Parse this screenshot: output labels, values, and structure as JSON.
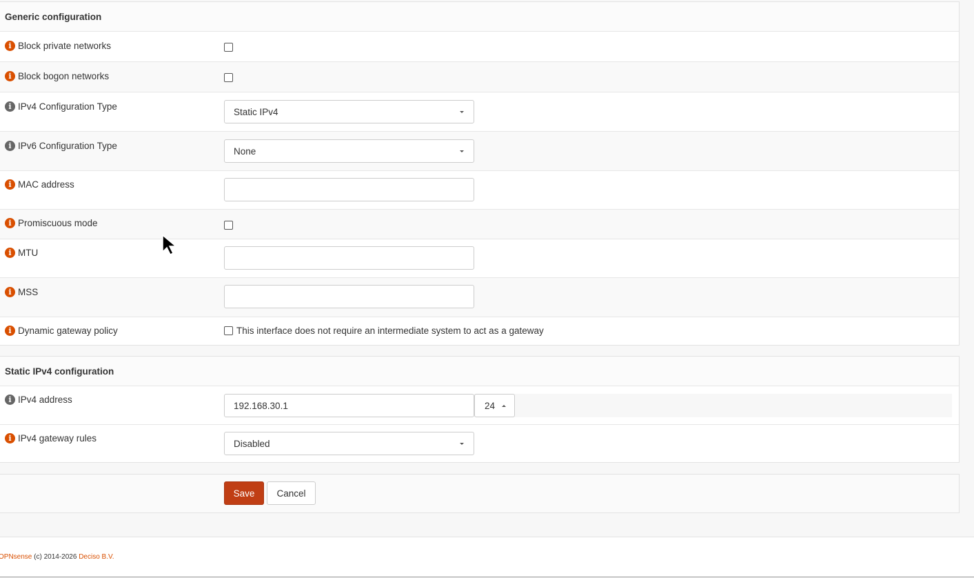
{
  "generic": {
    "header": "Generic configuration",
    "rows": {
      "block_private": {
        "label": "Block private networks",
        "checked": false
      },
      "block_bogon": {
        "label": "Block bogon networks",
        "checked": false
      },
      "ipv4_type": {
        "label": "IPv4 Configuration Type",
        "value": "Static IPv4"
      },
      "ipv6_type": {
        "label": "IPv6 Configuration Type",
        "value": "None"
      },
      "mac": {
        "label": "MAC address",
        "value": ""
      },
      "promisc": {
        "label": "Promiscuous mode",
        "checked": false
      },
      "mtu": {
        "label": "MTU",
        "value": ""
      },
      "mss": {
        "label": "MSS",
        "value": ""
      },
      "dyn_gw": {
        "label": "Dynamic gateway policy",
        "checkbox_text": "This interface does not require an intermediate system to act as a gateway",
        "checked": false
      }
    }
  },
  "static_ipv4": {
    "header": "Static IPv4 configuration",
    "rows": {
      "ipv4_address": {
        "label": "IPv4 address",
        "value": "192.168.30.1",
        "subnet": "24"
      },
      "gw_rules": {
        "label": "IPv4 gateway rules",
        "value": "Disabled"
      }
    }
  },
  "actions": {
    "save_label": "Save",
    "cancel_label": "Cancel"
  },
  "footer": {
    "brand": "OPNsense",
    "copyright": " (c) 2014-2026 ",
    "company": "Deciso B.V."
  },
  "colors": {
    "accent": "#d94f00",
    "save_button": "#c03e14",
    "info_orange": "#d94f00",
    "info_gray": "#666666"
  },
  "icons": {
    "info": "info-circle-icon",
    "caret": "caret-down-icon",
    "cursor": "mouse-pointer-icon"
  }
}
